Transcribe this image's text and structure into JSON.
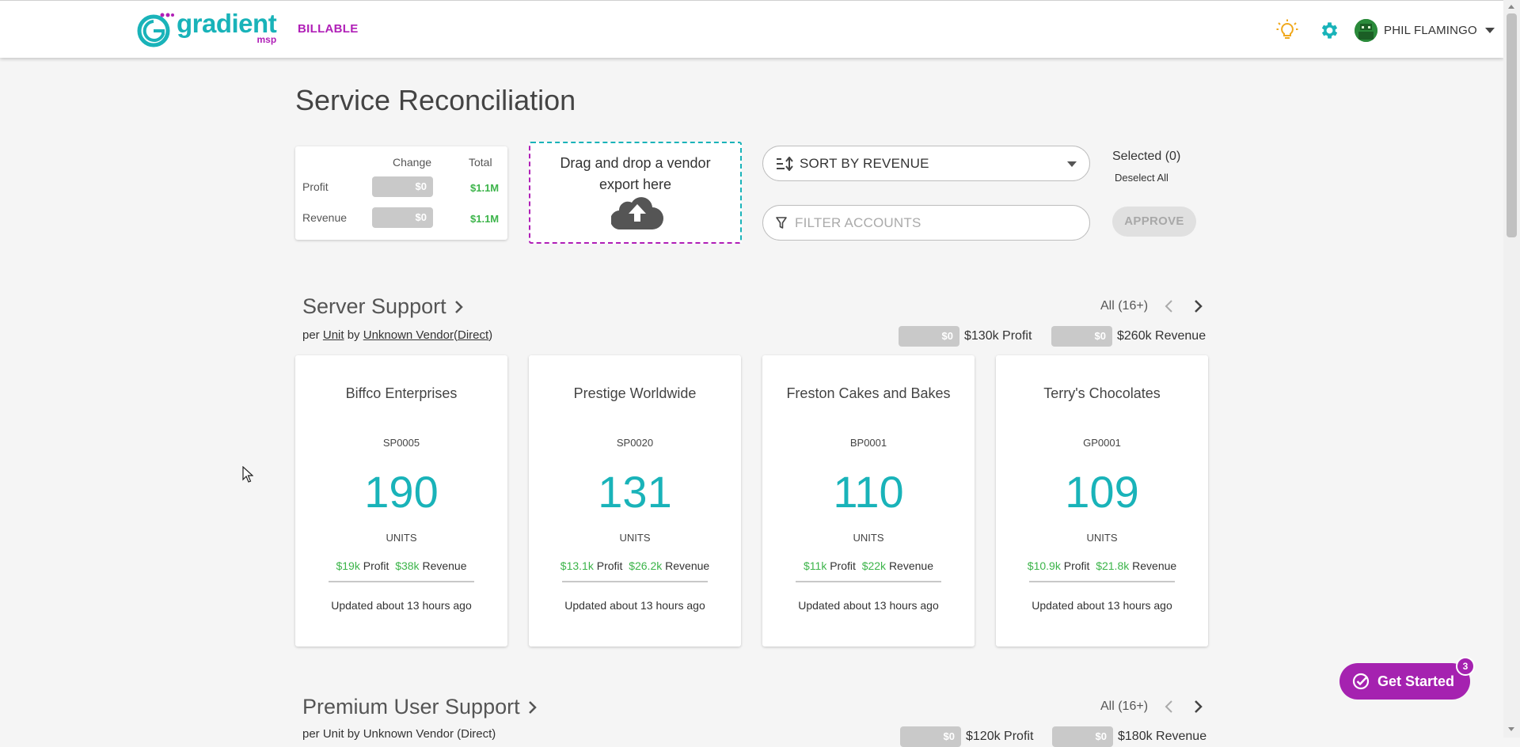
{
  "nav": {
    "logo_text": "gradient",
    "logo_sub": "msp",
    "billable": "BILLABLE",
    "user_name": "PHIL FLAMINGO"
  },
  "page": {
    "title": "Service Reconciliation"
  },
  "totals": {
    "change_header": "Change",
    "total_header": "Total",
    "rows": [
      {
        "label": "Profit",
        "change": "$0",
        "total": "$1.1M"
      },
      {
        "label": "Revenue",
        "change": "$0",
        "total": "$1.1M"
      }
    ]
  },
  "dropzone": {
    "text": "Drag and drop a vendor export here"
  },
  "controls": {
    "sort_label": "SORT BY REVENUE",
    "filter_placeholder": "FILTER ACCOUNTS",
    "selected": "Selected (0)",
    "deselect_all": "Deselect All",
    "approve": "APPROVE"
  },
  "sections": [
    {
      "title": "Server Support",
      "sub_per": "per",
      "sub_unit": "Unit",
      "sub_by": "by",
      "sub_vendor": "Unknown Vendor",
      "sub_direct": "Direct",
      "pager_label": "All (16+)",
      "profit_change": "$0",
      "profit_text": "$130k Profit",
      "revenue_change": "$0",
      "revenue_text": "$260k Revenue",
      "cards": [
        {
          "name": "Biffco Enterprises",
          "code": "SP0005",
          "units": "190",
          "units_label": "UNITS",
          "profit": "$19k",
          "profit_word": "Profit",
          "revenue": "$38k",
          "revenue_word": "Revenue",
          "updated": "Updated about 13 hours ago"
        },
        {
          "name": "Prestige Worldwide",
          "code": "SP0020",
          "units": "131",
          "units_label": "UNITS",
          "profit": "$13.1k",
          "profit_word": "Profit",
          "revenue": "$26.2k",
          "revenue_word": "Revenue",
          "updated": "Updated about 13 hours ago"
        },
        {
          "name": "Freston Cakes and Bakes",
          "code": "BP0001",
          "units": "110",
          "units_label": "UNITS",
          "profit": "$11k",
          "profit_word": "Profit",
          "revenue": "$22k",
          "revenue_word": "Revenue",
          "updated": "Updated about 13 hours ago"
        },
        {
          "name": "Terry's Chocolates",
          "code": "GP0001",
          "units": "109",
          "units_label": "UNITS",
          "profit": "$10.9k",
          "profit_word": "Profit",
          "revenue": "$21.8k",
          "revenue_word": "Revenue",
          "updated": "Updated about 13 hours ago"
        }
      ]
    },
    {
      "title": "Premium User Support",
      "sub_text": "per Unit by Unknown Vendor (Direct)",
      "pager_label": "All (16+)",
      "profit_change": "$0",
      "profit_text": "$120k Profit",
      "revenue_change": "$0",
      "revenue_text": "$180k Revenue"
    }
  ],
  "get_started": {
    "label": "Get Started",
    "badge": "3"
  },
  "colors": {
    "brand_teal": "#19b3b9",
    "brand_magenta": "#b01fb7",
    "positive_green": "#3cb44a",
    "get_started_purple": "#a522b0"
  }
}
